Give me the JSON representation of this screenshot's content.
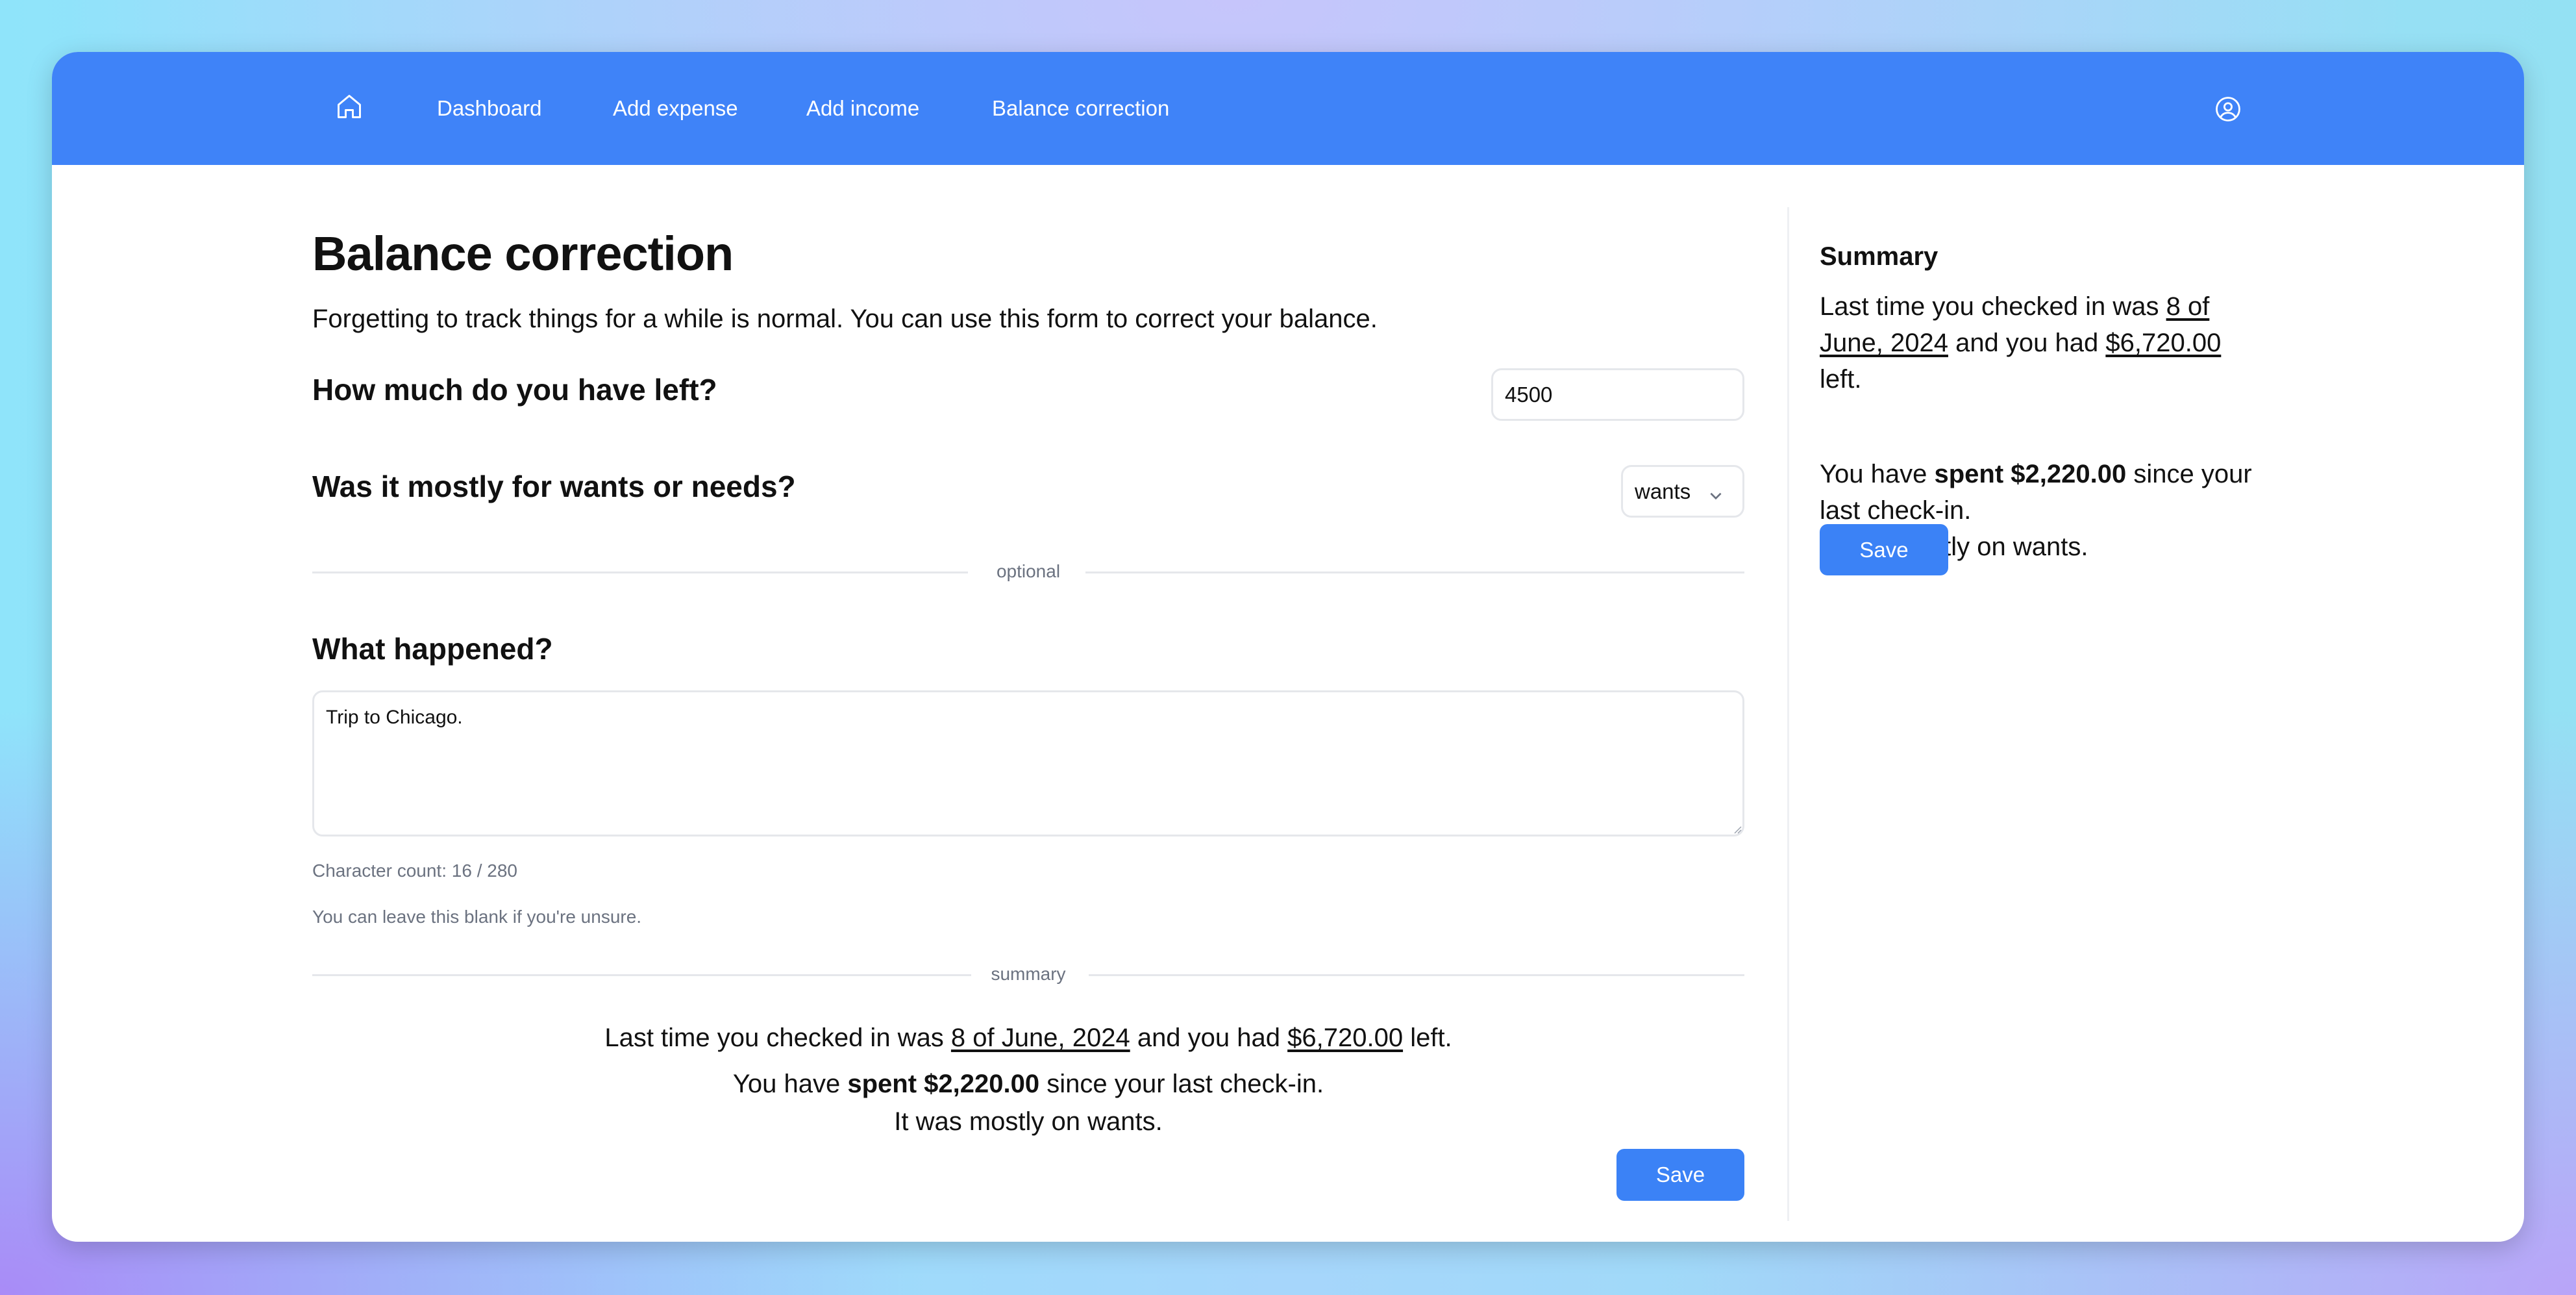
{
  "nav": {
    "home_icon": "home-icon",
    "items": [
      {
        "label": "Dashboard"
      },
      {
        "label": "Add expense"
      },
      {
        "label": "Add income"
      },
      {
        "label": "Balance correction"
      }
    ],
    "profile_icon": "user-circle-icon"
  },
  "page": {
    "title": "Balance correction",
    "subtitle": "Forgetting to track things for a while is normal. You can use this form to correct your balance."
  },
  "form": {
    "left_question": "How much do you have left?",
    "left_value": "4500",
    "type_question": "Was it mostly for wants or needs?",
    "type_value": "wants",
    "optional_divider": "optional",
    "what_question": "What happened?",
    "what_value": "Trip to Chicago.",
    "char_count": "Character count: 16 / 280",
    "hint": "You can leave this blank if you're unsure.",
    "summary_divider": "summary",
    "save_label": "Save"
  },
  "summary": {
    "heading": "Summary",
    "p1_a": "Last time you checked in was ",
    "date": "8 of June, 2024",
    "date_a": "8 of",
    "date_b": "June, 2024",
    "p1_b": " and you had ",
    "amount": "$6,720.00",
    "p1_c": " left.",
    "p1_c_side": "left.",
    "p2_a": "You have ",
    "spent": "spent $2,220.00",
    "p2_b": " since your last check-in.",
    "p2_b_side_1": " since your",
    "p2_b_side_2": "last check-in.",
    "p3": "It was mostly on wants.",
    "save_label": "Save"
  },
  "colors": {
    "accent": "#3f83f8",
    "button": "#3b82f6"
  }
}
